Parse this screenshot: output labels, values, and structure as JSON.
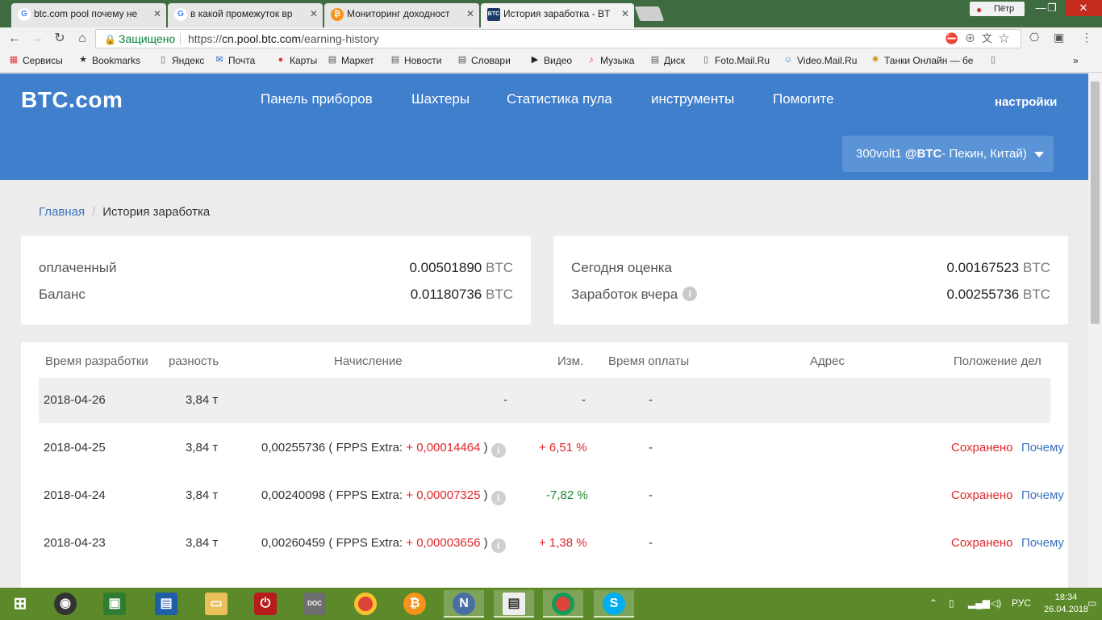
{
  "browser": {
    "tabs": [
      {
        "label": "btc.com pool почему не",
        "icon": "google-icon"
      },
      {
        "label": "в какой промежуток вр",
        "icon": "google-icon"
      },
      {
        "label": "Мониторинг доходност",
        "icon": "bitcoin-icon"
      },
      {
        "label": "История заработка - BT",
        "icon": "btc-com-icon",
        "active": true
      }
    ],
    "profile": "Пётр",
    "secure_label": "Защищено",
    "url_prefix": "https://",
    "url_host": "cn.pool.btc.com",
    "url_path": "/earning-history",
    "bookmarks": [
      {
        "label": "Сервисы",
        "icon": "apps-icon"
      },
      {
        "label": "Bookmarks",
        "icon": "star-icon"
      },
      {
        "label": "Яндекс",
        "icon": "page-icon"
      },
      {
        "label": "Почта",
        "icon": "mail-icon"
      },
      {
        "label": "Карты",
        "icon": "map-pin-icon"
      },
      {
        "label": "Маркет",
        "icon": "market-icon"
      },
      {
        "label": "Новости",
        "icon": "page-icon"
      },
      {
        "label": "Словари",
        "icon": "dictionary-icon"
      },
      {
        "label": "Видео",
        "icon": "video-icon"
      },
      {
        "label": "Музыка",
        "icon": "music-icon"
      },
      {
        "label": "Диск",
        "icon": "page-icon"
      },
      {
        "label": "Foto.Mail.Ru",
        "icon": "page-icon"
      },
      {
        "label": "Video.Mail.Ru",
        "icon": "video-mail-icon"
      },
      {
        "label": "Танки Онлайн — бе",
        "icon": "tanki-icon"
      }
    ],
    "bookmarks_more": "»"
  },
  "site": {
    "logo": "BTC.com",
    "nav": [
      "Панель приборов",
      "Шахтеры",
      "Статистика пула",
      "инструменты",
      "Помогите"
    ],
    "settings": "настройки",
    "account_name": "300volt1",
    "account_coin": "@BTC",
    "account_region": "- Пекин, Китай)"
  },
  "breadcrumb": {
    "home": "Главная",
    "separator": "/",
    "current": "История заработка"
  },
  "summary_left": [
    {
      "label": "оплаченный",
      "value": "0.00501890",
      "unit": "BTC"
    },
    {
      "label": "Баланс",
      "value": "0.01180736",
      "unit": "BTC"
    }
  ],
  "summary_right": [
    {
      "label": "Сегодня оценка",
      "value": "0.00167523",
      "unit": "BTC"
    },
    {
      "label": "Заработок вчера",
      "value": "0.00255736",
      "unit": "BTC"
    }
  ],
  "table": {
    "headers": [
      "Время разработки",
      "разность",
      "Начисление",
      "Изм.",
      "Время оплаты",
      "Адрес",
      "Положение дел"
    ],
    "rows": [
      {
        "date": "2018-04-26",
        "difficulty": "3,84 т",
        "amount": "",
        "extra_label": "",
        "extra": "",
        "change": "-",
        "change_color": "neutral",
        "paid_time": "-",
        "address": "",
        "status": "",
        "why": "",
        "amount_dash": "-"
      },
      {
        "date": "2018-04-25",
        "difficulty": "3,84 т",
        "amount": "0,00255736 ( ",
        "extra_label": "FPPS Extra:",
        "extra": " + 0,00014464 ",
        "close": ")",
        "change": "+ 6,51 %",
        "change_color": "red",
        "paid_time": "-",
        "address": "",
        "status": "Сохранено",
        "why": "Почему"
      },
      {
        "date": "2018-04-24",
        "difficulty": "3,84 т",
        "amount": "0,00240098 ( ",
        "extra_label": "FPPS Extra:",
        "extra": " + 0,00007325 ",
        "close": ")",
        "change": "-7,82 %",
        "change_color": "green",
        "paid_time": "-",
        "address": "",
        "status": "Сохранено",
        "why": "Почему"
      },
      {
        "date": "2018-04-23",
        "difficulty": "3,84 т",
        "amount": "0,00260459 ( ",
        "extra_label": "FPPS Extra:",
        "extra": " + 0,00003656 ",
        "close": ")",
        "change": "+ 1,38 %",
        "change_color": "red",
        "paid_time": "-",
        "address": "",
        "status": "Сохранено",
        "why": "Почему"
      }
    ]
  },
  "taskbar": {
    "apps": [
      "start-icon",
      "speaker-app-icon",
      "store-icon",
      "settings-app-icon",
      "folder-icon",
      "power-app-icon",
      "doc-app-icon",
      "chrome-icon",
      "bitcoin-app-icon",
      "n-app-icon",
      "window-app-icon",
      "chrome-active-icon",
      "skype-icon"
    ],
    "lang": "РУС",
    "time": "18:34",
    "date": "26.04.2018"
  },
  "colors": {
    "header_blue": "#3f7fcc",
    "account_blue": "#5a93d6",
    "red": "#e0262b",
    "green": "#1e8a2e",
    "link": "#3a74bf",
    "taskbar": "#5c8a2a"
  }
}
